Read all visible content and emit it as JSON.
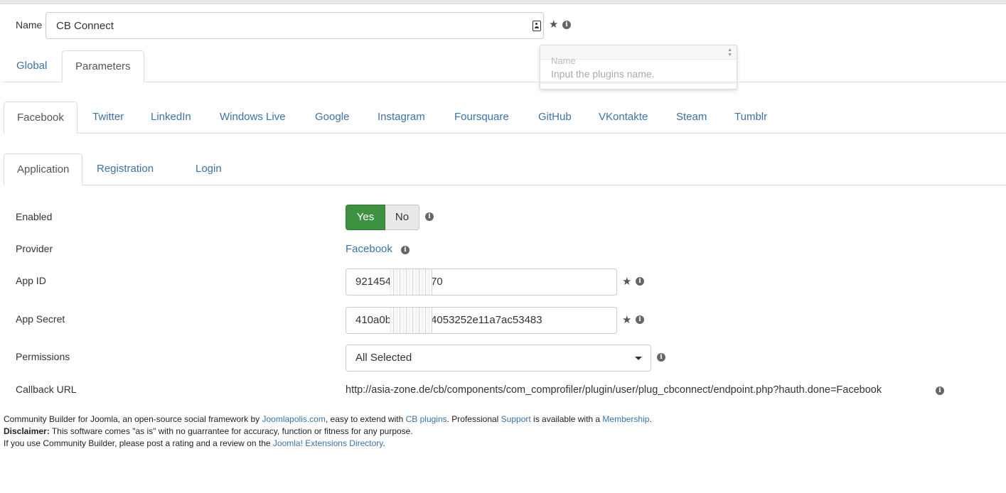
{
  "name_field": {
    "label": "Name",
    "value": "CB Connect"
  },
  "tooltip": {
    "title": "Name",
    "body": "Input the plugins name."
  },
  "main_tabs": [
    {
      "label": "Global",
      "active": false
    },
    {
      "label": "Parameters",
      "active": true
    }
  ],
  "provider_tabs": [
    {
      "label": "Facebook",
      "active": true
    },
    {
      "label": "Twitter"
    },
    {
      "label": "LinkedIn"
    },
    {
      "label": "Windows Live"
    },
    {
      "label": "Google"
    },
    {
      "label": "Instagram"
    },
    {
      "label": "Foursquare"
    },
    {
      "label": "GitHub"
    },
    {
      "label": "VKontakte"
    },
    {
      "label": "Steam"
    },
    {
      "label": "Tumblr"
    }
  ],
  "sub_tabs": [
    {
      "label": "Application",
      "active": true
    },
    {
      "label": "Registration"
    },
    {
      "label": "Login"
    }
  ],
  "form": {
    "enabled": {
      "label": "Enabled",
      "yes": "Yes",
      "no": "No",
      "selected": "Yes"
    },
    "provider": {
      "label": "Provider",
      "value": "Facebook"
    },
    "app_id": {
      "label": "App ID",
      "prefix": "921454",
      "suffix": "70"
    },
    "app_secret": {
      "label": "App Secret",
      "prefix": "410a0b",
      "suffix": "4053252e11a7ac53483"
    },
    "permissions": {
      "label": "Permissions",
      "value": "All Selected"
    },
    "callback_url": {
      "label": "Callback URL",
      "value": "http://asia-zone.de/cb/components/com_comprofiler/plugin/user/plug_cbconnect/endpoint.php?hauth.done=Facebook"
    }
  },
  "footer": {
    "line1": {
      "t1": "Community Builder for Joomla, an open-source social framework by ",
      "l1": "Joomlapolis.com",
      "t2": ", easy to extend with ",
      "l2": "CB plugins",
      "t3": ". Professional ",
      "l3": "Support",
      "t4": " is available with a ",
      "l4": "Membership",
      "t5": "."
    },
    "line2": {
      "bold": "Disclaimer:",
      "text": " This software comes \"as is\" with no guarrantee for accuracy, function or fitness for any purpose."
    },
    "line3": {
      "t1": "If you use Community Builder, please post a rating and a review on the ",
      "l1": "Joomla! Extensions Directory",
      "t2": "."
    }
  },
  "colors": {
    "link": "#3a73a8",
    "yes_green": "#3f9142",
    "border": "#dddddd"
  },
  "icons": [
    "contact-card-icon",
    "star-icon",
    "info-icon",
    "caret-down-icon",
    "scroll-arrows-icon"
  ]
}
